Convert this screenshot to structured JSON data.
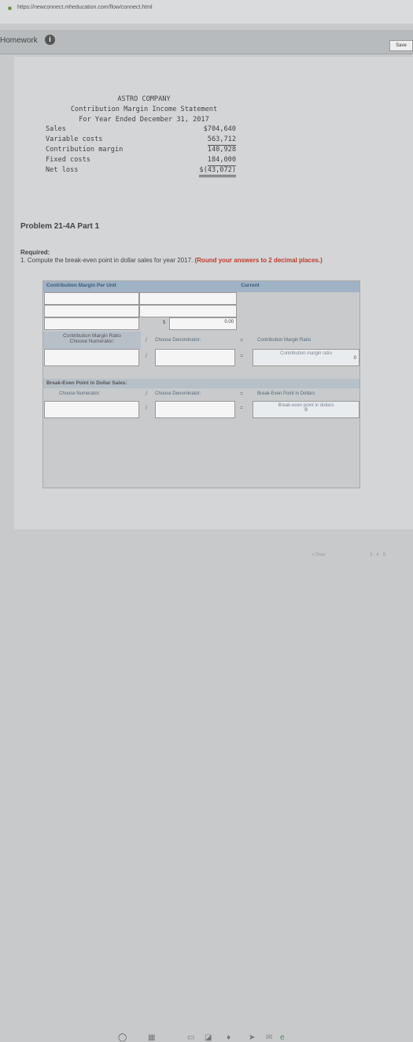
{
  "browser": {
    "url": "https://newconnect.mheducation.com/flow/connect.html"
  },
  "header": {
    "title": "Homework",
    "save_label": "Save"
  },
  "statement": {
    "company": "ASTRO COMPANY",
    "title": "Contribution Margin Income Statement",
    "period": "For Year Ended December 31, 2017",
    "rows": [
      {
        "label": "Sales",
        "value": "$704,640"
      },
      {
        "label": "Variable costs",
        "value": "563,712"
      },
      {
        "label": "Contribution margin",
        "value": "140,928"
      },
      {
        "label": "Fixed costs",
        "value": "184,000"
      },
      {
        "label": "Net loss",
        "value": "$(43,072)"
      }
    ]
  },
  "problem": {
    "title": "Problem 21-4A Part 1",
    "required_label": "Required:",
    "instruction": "1. Compute the break-even point in dollar sales for year 2017.",
    "round_note": "(Round your answers to 2 decimal places.)"
  },
  "table": {
    "cm_per_unit_header": "Contribution Margin Per Unit",
    "current_header": "Current",
    "dollar_sign": "$",
    "cm_value": "0.00",
    "ratio_header": "Contribution Margin Ratio",
    "choose_numerator": "Choose Numerator:",
    "choose_denominator": "Choose Denominator:",
    "divide": "/",
    "equals": "=",
    "ratio_result_label": "Contribution Margin Ratio",
    "ratio_result_sub": "Contribution margin ratio",
    "ratio_value": "0",
    "bep_header": "Break-Even Point in Dollar Sales:",
    "bep_result_label": "Break-Even Point in Dollars",
    "bep_result_sub": "Break-even point in dollars",
    "bep_value": "0"
  },
  "footer": {
    "prev": "< Prev",
    "pages": [
      "3",
      "4",
      "5"
    ]
  }
}
